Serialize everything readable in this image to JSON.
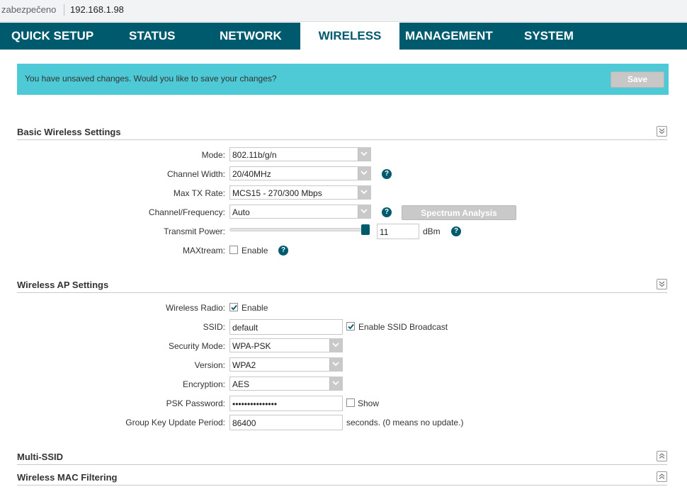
{
  "browser": {
    "security_label": "zabezpečeno",
    "url": "192.168.1.98"
  },
  "nav": {
    "tabs": [
      {
        "label": "QUICK SETUP"
      },
      {
        "label": "STATUS"
      },
      {
        "label": "NETWORK"
      },
      {
        "label": "WIRELESS"
      },
      {
        "label": "MANAGEMENT"
      },
      {
        "label": "SYSTEM"
      }
    ],
    "active": "WIRELESS"
  },
  "banner": {
    "message": "You have unsaved changes. Would you like to save your changes?",
    "save_label": "Save"
  },
  "basic": {
    "title": "Basic Wireless Settings",
    "mode_label": "Mode:",
    "mode_value": "802.11b/g/n",
    "channel_width_label": "Channel Width:",
    "channel_width_value": "20/40MHz",
    "max_tx_label": "Max TX Rate:",
    "max_tx_value": "MCS15 - 270/300 Mbps",
    "channel_freq_label": "Channel/Frequency:",
    "channel_freq_value": "Auto",
    "spectrum_label": "Spectrum Analysis",
    "tx_power_label": "Transmit Power:",
    "tx_power_value": "11",
    "tx_power_unit": "dBm",
    "tx_power_level": 1.0,
    "maxtream_label": "MAXtream:",
    "maxtream_enable": "Enable",
    "help_glyph": "?"
  },
  "ap": {
    "title": "Wireless AP Settings",
    "radio_label": "Wireless Radio:",
    "radio_enable": "Enable",
    "radio_checked": true,
    "ssid_label": "SSID:",
    "ssid_value": "default",
    "ssid_broadcast": "Enable SSID Broadcast",
    "ssid_broadcast_checked": true,
    "security_label": "Security Mode:",
    "security_value": "WPA-PSK",
    "version_label": "Version:",
    "version_value": "WPA2",
    "encryption_label": "Encryption:",
    "encryption_value": "AES",
    "psk_label": "PSK Password:",
    "psk_value": "•••••••••••••••",
    "show_label": "Show",
    "show_checked": false,
    "group_key_label": "Group Key Update Period:",
    "group_key_value": "86400",
    "group_key_hint": "seconds. (0 means no update.)"
  },
  "sections": {
    "multi_ssid": "Multi-SSID",
    "mac_filtering": "Wireless MAC Filtering"
  },
  "colors": {
    "nav_bg": "#005a6e",
    "banner_bg": "#4ecad6",
    "help_bg": "#005a6e"
  }
}
